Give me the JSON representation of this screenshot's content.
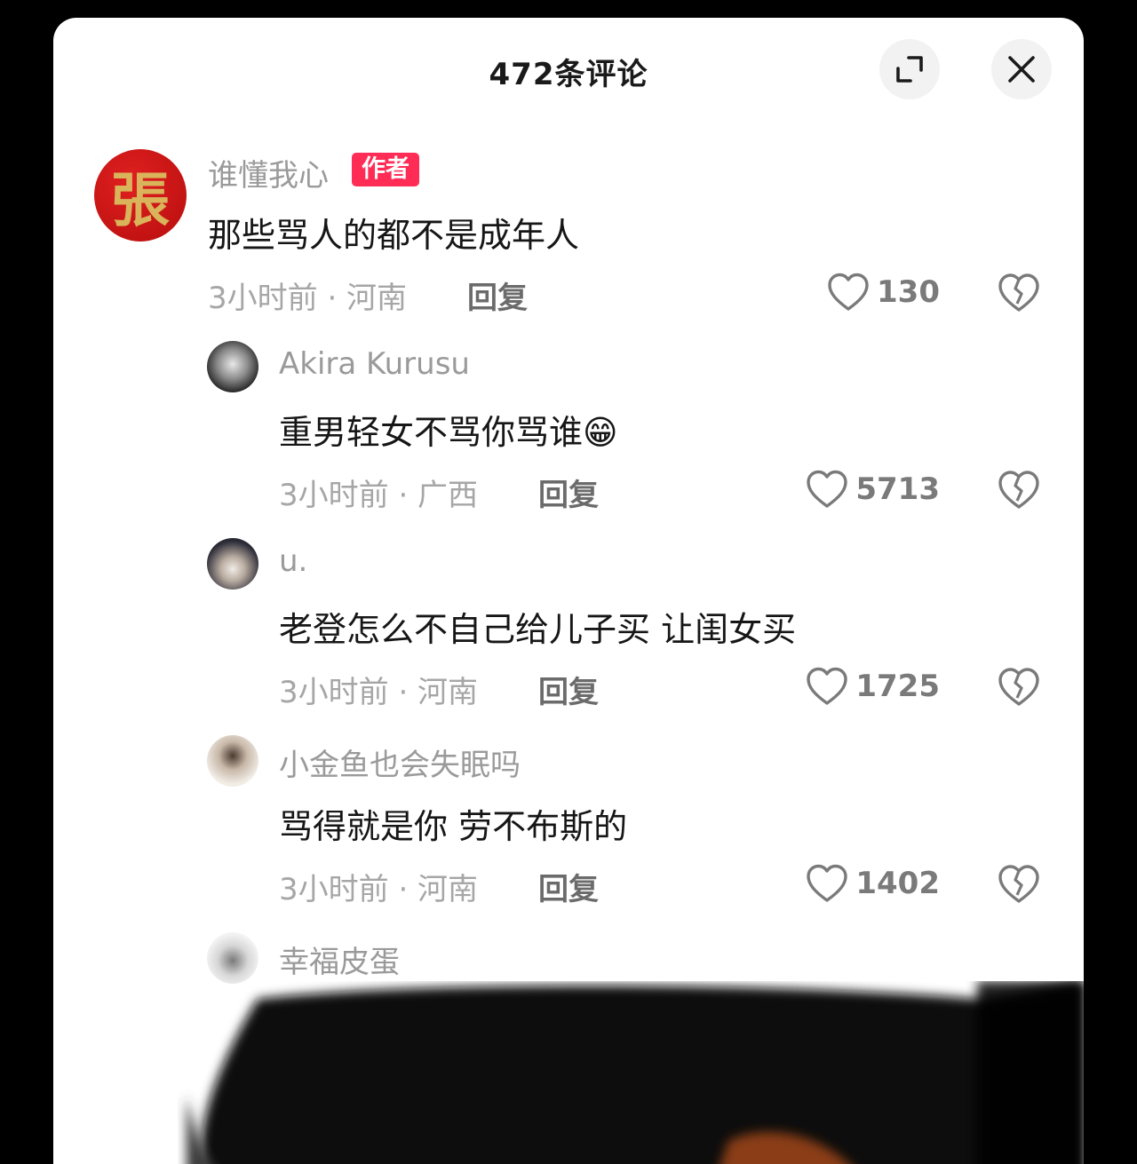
{
  "header": {
    "title": "472条评论"
  },
  "comments": [
    {
      "username": "谁懂我心",
      "badge": "作者",
      "text": "那些骂人的都不是成年人",
      "meta": "3小时前 · 河南",
      "reply": "回复",
      "likes": "130",
      "avatar": "seal-character-avatar",
      "avatar_glyph": "張"
    },
    {
      "username": "Akira Kurusu",
      "text": "重男轻女不骂你骂谁",
      "emoji": "😁",
      "meta": "3小时前 · 广西",
      "reply": "回复",
      "likes": "5713",
      "avatar": "photo-avatar"
    },
    {
      "username": "u.",
      "text": "老登怎么不自己给儿子买 让闺女买",
      "meta": "3小时前 · 河南",
      "reply": "回复",
      "likes": "1725",
      "avatar": "photo-avatar"
    },
    {
      "username": "小金鱼也会失眠吗",
      "text": "骂得就是你 劳不布斯的",
      "meta": "3小时前 · 河南",
      "reply": "回复",
      "likes": "1402",
      "avatar": "photo-avatar"
    },
    {
      "username": "幸福皮蛋",
      "avatar": "photo-avatar"
    }
  ],
  "icons": {
    "expand": "expand-icon",
    "close": "close-icon",
    "like": "heart-icon",
    "dislike": "broken-heart-icon"
  },
  "colors": {
    "badge": "#ff2c55",
    "username": "#9a9a9a",
    "text": "#161616"
  }
}
